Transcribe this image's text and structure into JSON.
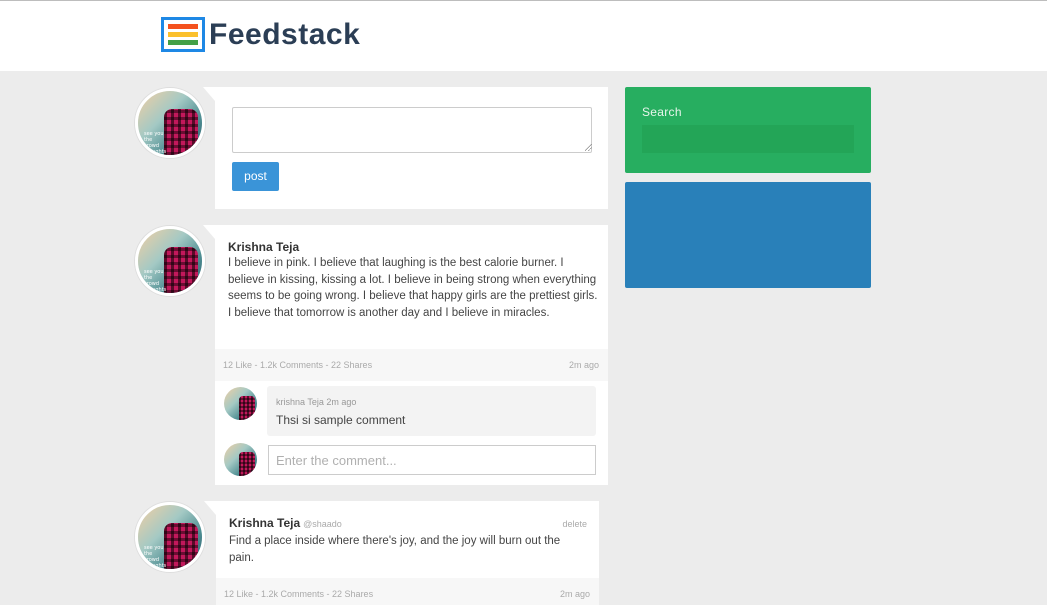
{
  "brand": {
    "name": "Feedstack",
    "logo_bar_colors": [
      "#f4511e",
      "#fbc02d",
      "#43a047"
    ]
  },
  "composer": {
    "placeholder": "",
    "post_label": "post",
    "avatar_caption": "see you the crowd thoughts"
  },
  "posts": [
    {
      "author": "Krishna Teja",
      "handle": "",
      "text": "I believe in pink. I believe that laughing is the best calorie burner. I believe in kissing, kissing a lot. I believe in being strong when everything seems to be going wrong. I believe that happy girls are the prettiest girls. I believe that tomorrow is another day and I believe in miracles.",
      "stats": "12 Like - 1.2k Comments - 22 Shares",
      "time": "2m ago",
      "comments": [
        {
          "author_time": "krishna Teja 2m ago",
          "text": "Thsi si sample comment"
        }
      ],
      "comment_placeholder": "Enter the comment..."
    },
    {
      "author": "Krishna Teja",
      "handle": "@shaado",
      "delete_label": "delete",
      "text": "Find a place inside where there's joy, and the joy will burn out the pain.",
      "stats": "12 Like - 1.2k Comments - 22 Shares",
      "time": "2m ago"
    }
  ],
  "sidebar": {
    "search_label": "Search",
    "search_value": "",
    "search_color": "#27ae60",
    "panel_color": "#2980b9"
  }
}
